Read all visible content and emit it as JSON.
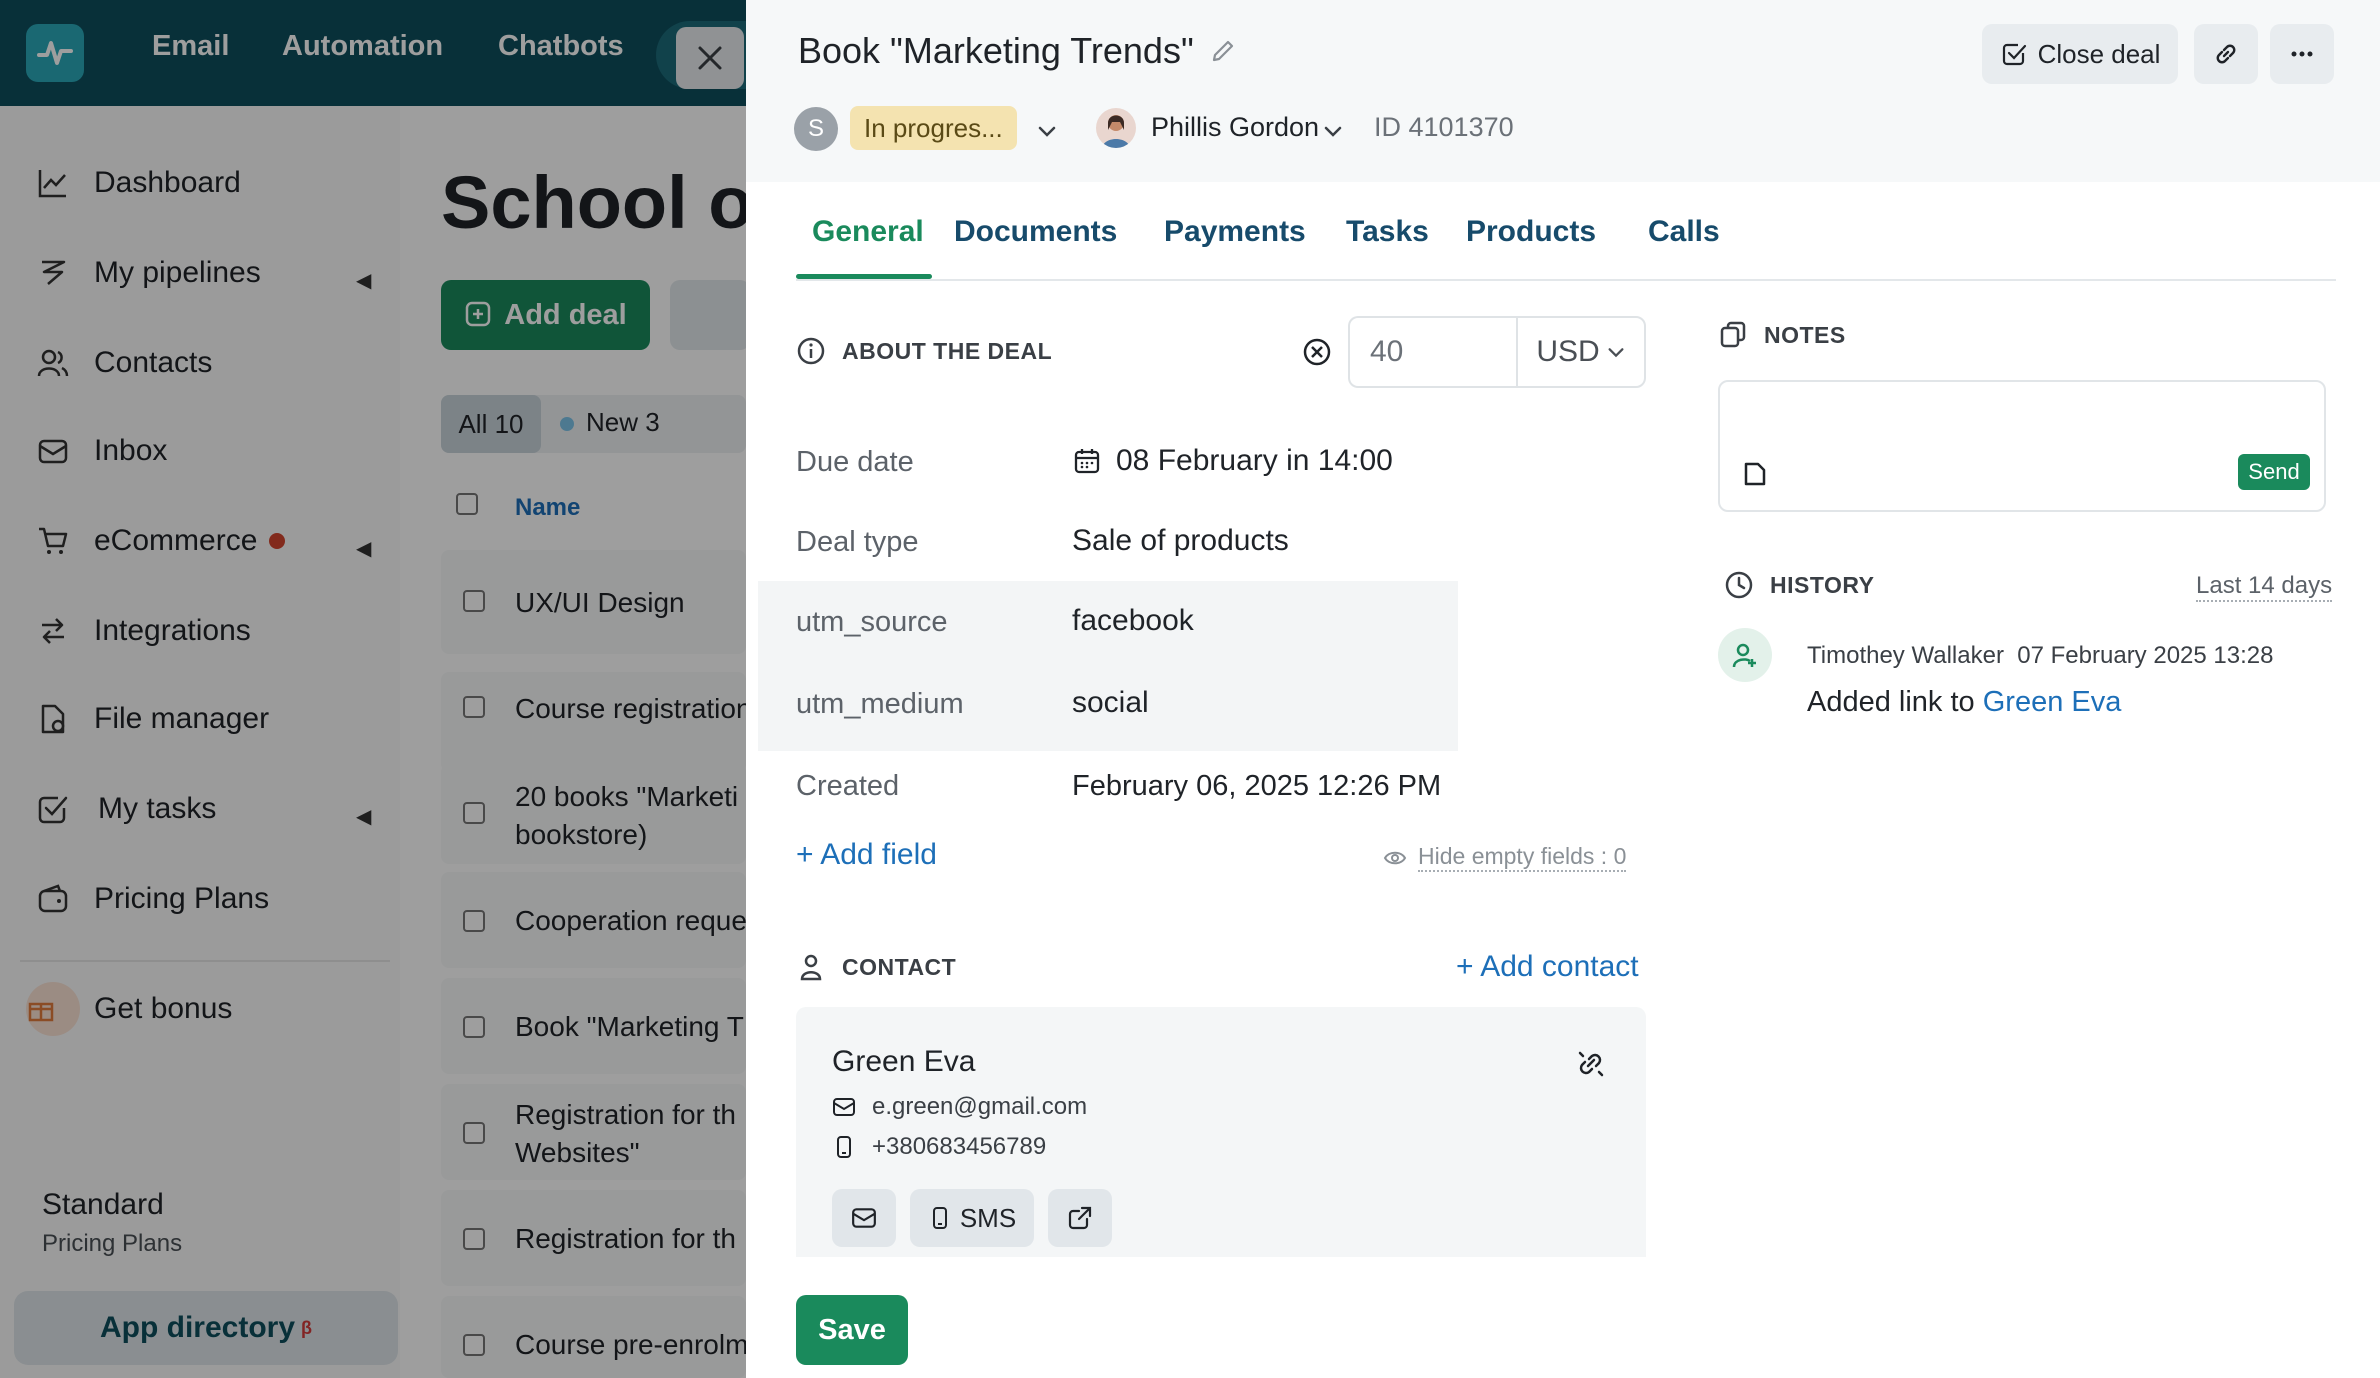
{
  "app": {
    "nav": [
      "Email",
      "Automation",
      "Chatbots"
    ],
    "sidebar": [
      {
        "label": "Dashboard",
        "icon": "chart-icon"
      },
      {
        "label": "My pipelines",
        "icon": "pipeline-icon"
      },
      {
        "label": "Contacts",
        "icon": "contacts-icon"
      },
      {
        "label": "Inbox",
        "icon": "inbox-icon"
      },
      {
        "label": "eCommerce",
        "icon": "cart-icon"
      },
      {
        "label": "Integrations",
        "icon": "integrations-icon"
      },
      {
        "label": "File manager",
        "icon": "file-icon"
      },
      {
        "label": "My tasks",
        "icon": "tasks-icon"
      },
      {
        "label": "Pricing Plans",
        "icon": "wallet-icon"
      },
      {
        "label": "Get bonus",
        "icon": "gift-icon"
      }
    ],
    "plan_name": "Standard",
    "plan_sub": "Pricing Plans",
    "app_directory": "App directory",
    "app_directory_badge": "β",
    "page_title": "School of",
    "add_deal": "Add deal",
    "filter_all": "All 10",
    "filter_new": "New 3",
    "column_name": "Name",
    "deals": [
      "UX/UI Design",
      "Course registration",
      "20 books \"Marketi",
      "bookstore)",
      "Cooperation reque",
      "Book \"Marketing T",
      "Registration for th",
      "Websites\"",
      "Registration for th",
      "Course pre-enrolm"
    ]
  },
  "panel": {
    "title": "Book \"Marketing Trends\"",
    "close_deal": "Close deal",
    "status_initial": "S",
    "status": "In progres...",
    "owner": "Phillis Gordon",
    "deal_id": "ID 4101370",
    "tabs": [
      "General",
      "Documents",
      "Payments",
      "Tasks",
      "Products",
      "Calls"
    ],
    "about_title": "ABOUT THE DEAL",
    "amount": "40",
    "currency": "USD",
    "fields": [
      {
        "label": "Due date",
        "value": "08 February in 14:00"
      },
      {
        "label": "Deal type",
        "value": "Sale of products"
      },
      {
        "label": "utm_source",
        "value": "facebook"
      },
      {
        "label": "utm_medium",
        "value": "social"
      },
      {
        "label": "Created",
        "value": "February 06, 2025 12:26 PM"
      }
    ],
    "add_field": "+ Add field",
    "hide_empty": "Hide empty fields : 0",
    "contact_title": "CONTACT",
    "add_contact": "+ Add contact",
    "contact": {
      "name": "Green Eva",
      "email": "e.green@gmail.com",
      "phone": "+380683456789",
      "sms": "SMS"
    },
    "save": "Save",
    "notes_title": "NOTES",
    "send": "Send",
    "history_title": "HISTORY",
    "history_range": "Last 14 days",
    "history": {
      "author": "Timothey Wallaker",
      "date": "07 February 2025 13:28",
      "text": "Added link to",
      "link": "Green Eva"
    }
  },
  "colors": {
    "brand_dark": "#0d4e5c",
    "accent_green": "#1a8a5c",
    "link_blue": "#1d6fb8",
    "status_pill": "#f4e3b0"
  }
}
